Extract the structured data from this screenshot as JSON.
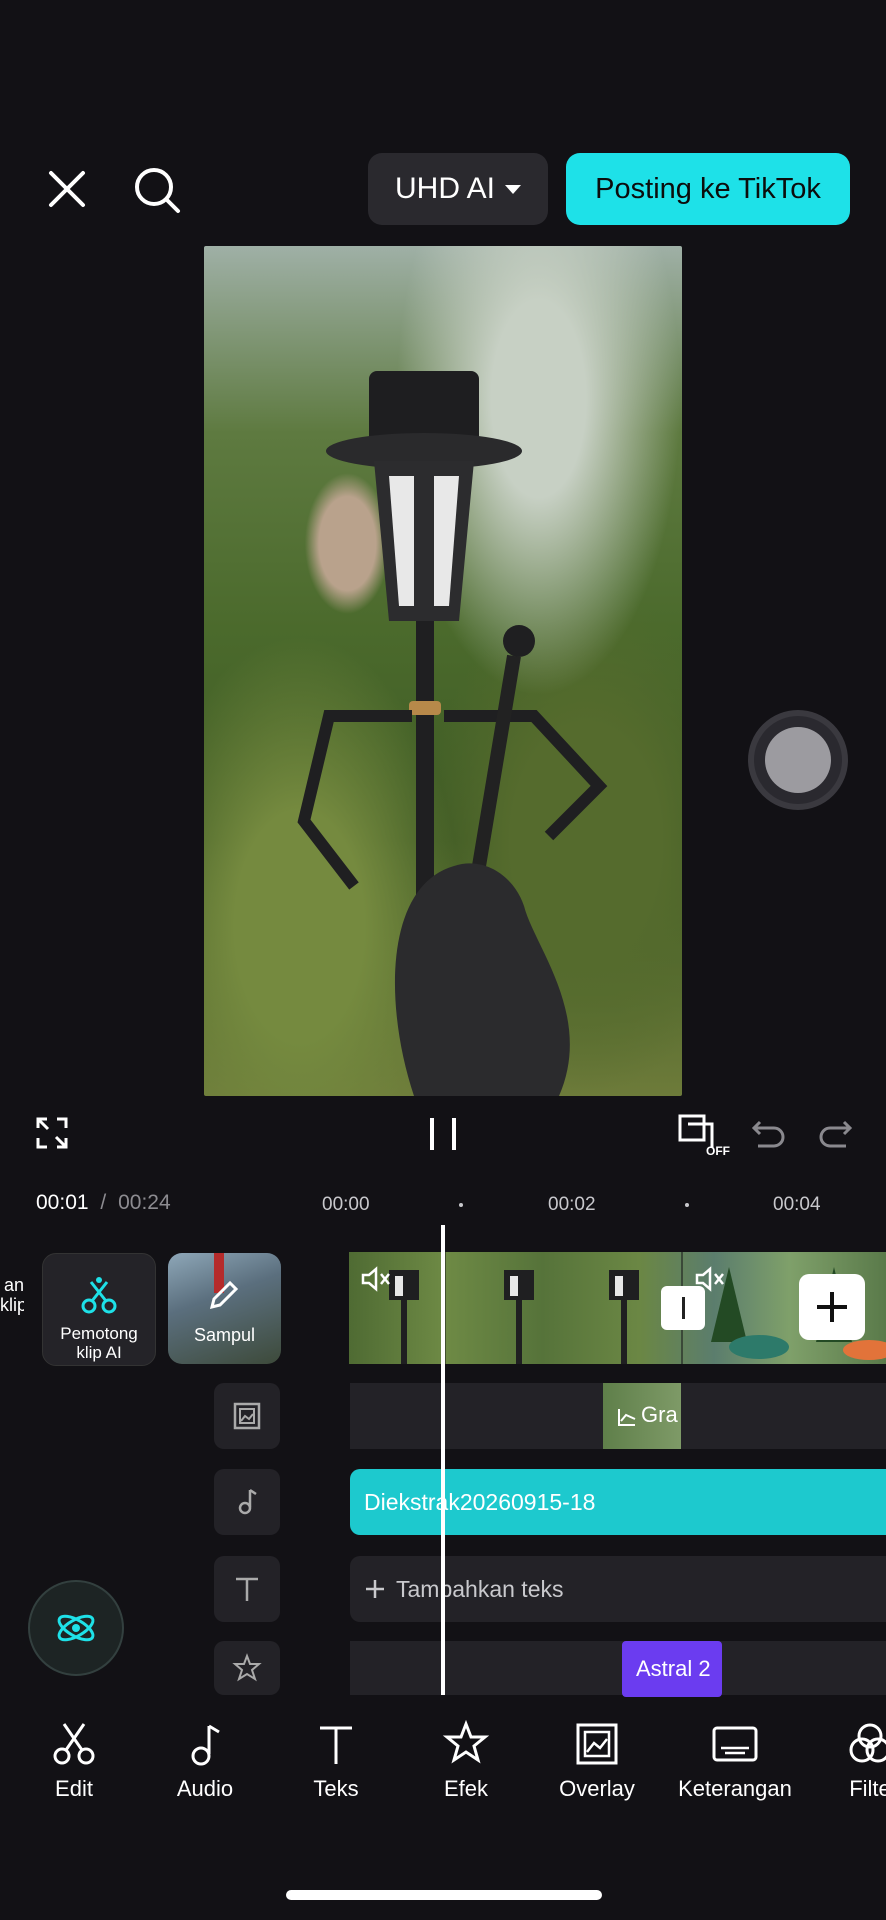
{
  "topbar": {
    "quality_label": "UHD AI",
    "post_label": "Posting ke TikTok"
  },
  "colors": {
    "accent": "#1ee1e8",
    "background": "#121115",
    "effect_purple": "#6b3cf0"
  },
  "player": {
    "current_time": "00:01",
    "separator": "/",
    "total_time": "00:24",
    "off_badge": "OFF"
  },
  "ruler": {
    "ticks": [
      "00:00",
      "00:02",
      "00:04"
    ]
  },
  "left_tiles": {
    "partial_top": "an",
    "partial_bottom": "klip",
    "ai_cut_line1": "Pemotong",
    "ai_cut_line2": "klip AI",
    "cover": "Sampul"
  },
  "tracks": {
    "overlay_clip": "Gra",
    "audio_clip": "Diekstrak20260915-18",
    "add_text": "Tambahkan teks",
    "effect_clip": "Astral 2"
  },
  "toolbar": {
    "items": [
      "Edit",
      "Audio",
      "Teks",
      "Efek",
      "Overlay",
      "Keterangan",
      "Filte"
    ]
  },
  "icons": [
    "close-icon",
    "search-icon",
    "caret-down-icon",
    "fullscreen-icon",
    "pause-icon",
    "crop-off-icon",
    "undo-icon",
    "redo-icon",
    "scissors-icon",
    "music-note-icon",
    "text-icon",
    "star-effect-icon",
    "overlay-icon",
    "caption-icon",
    "filter-icon",
    "plus-icon",
    "mute-icon",
    "ai-assist-icon"
  ]
}
